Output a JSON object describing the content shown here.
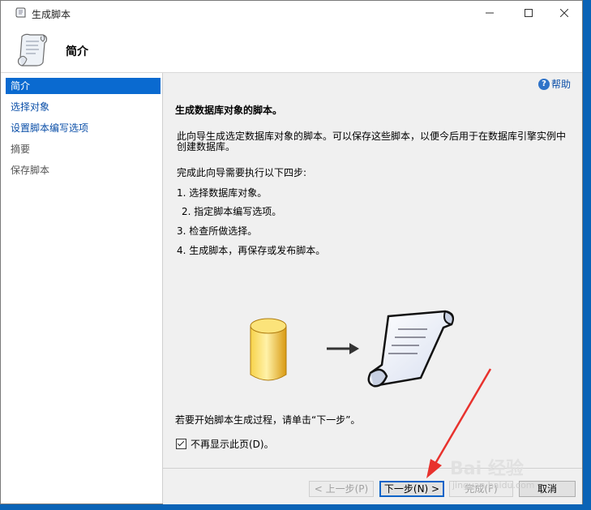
{
  "window": {
    "title": "生成脚本"
  },
  "header": {
    "title": "简介"
  },
  "sidebar": {
    "items": [
      {
        "label": "简介",
        "state": "active"
      },
      {
        "label": "选择对象",
        "state": "link"
      },
      {
        "label": "设置脚本编写选项",
        "state": "link"
      },
      {
        "label": "摘要",
        "state": "disabled"
      },
      {
        "label": "保存脚本",
        "state": "disabled"
      }
    ]
  },
  "content": {
    "help_label": "帮助",
    "heading": "生成数据库对象的脚本。",
    "description": "此向导生成选定数据库对象的脚本。可以保存这些脚本，以便今后用于在数据库引擎实例中创建数据库。",
    "steps_intro": "完成此向导需要执行以下四步:",
    "steps": [
      "1. 选择数据库对象。",
      "2. 指定脚本编写选项。",
      "3. 检查所做选择。",
      "4. 生成脚本，再保存或发布脚本。"
    ],
    "start_hint": "若要开始脚本生成过程，请单击“下一步”。",
    "dont_show_label": "不再显示此页(D)。",
    "dont_show_checked": true
  },
  "footer": {
    "prev_label": "< 上一步(P)",
    "next_label": "下一步(N) >",
    "finish_label": "完成(F)",
    "cancel_label": "取消"
  },
  "watermark": {
    "text": "Bai 经验",
    "sub": "jingyan.baidu.com"
  },
  "colors": {
    "accent": "#0a6ad0",
    "link": "#0b4fa8",
    "desktop": "#0a63b6",
    "annotation": "#e8322d"
  }
}
